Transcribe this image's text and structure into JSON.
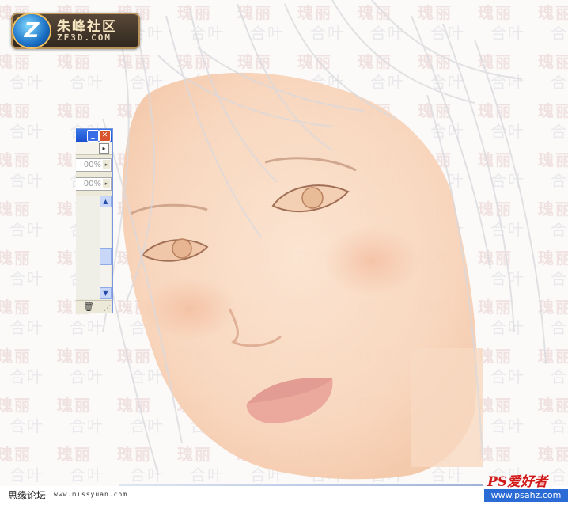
{
  "logo": {
    "title": "朱峰社区",
    "subtitle": "ZF3D.COM",
    "emblem": "Z",
    "icon": "zf3d-logo-icon"
  },
  "watermark": {
    "line1": "瑰丽",
    "line2": "合叶"
  },
  "palette": {
    "minimize_icon": "minimize-icon",
    "close_icon": "close-icon",
    "minimize_glyph": "_",
    "close_glyph": "✕",
    "menu_arrow": "▸",
    "opacity_value": "00%",
    "fill_value": "00%",
    "field_arrow": "▸",
    "scroll_up": "▲",
    "scroll_down": "▼",
    "trash_glyph": "🗑",
    "grip_glyph": "⋰"
  },
  "footer": {
    "forum_name": "思缘论坛",
    "url": "www.missyuan.com"
  },
  "ps_badge": {
    "name": "PS爱好者",
    "url": "www.psahz.com"
  },
  "colors": {
    "titlebar": "#1b4fd1",
    "close_button": "#d9542c",
    "watermark_red": "#f1e2e2",
    "ps_red": "#d31a1a",
    "ps_blue": "#2b6bd6"
  }
}
